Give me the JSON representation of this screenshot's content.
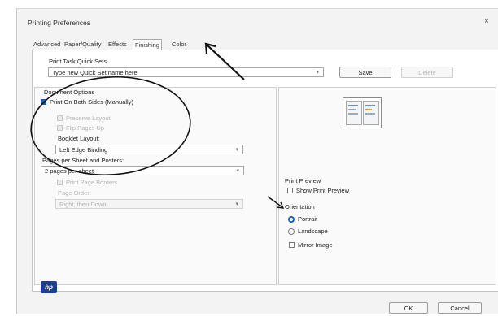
{
  "window": {
    "title": "Printing Preferences",
    "close": "×"
  },
  "tabs": [
    "Advanced",
    "Paper/Quality",
    "Effects",
    "Finishing",
    "Color"
  ],
  "active_tab": "Finishing",
  "quick_sets": {
    "label": "Print Task Quick Sets",
    "value": "Type new Quick Set name here",
    "save": "Save",
    "delete": "Delete"
  },
  "document_options": {
    "label": "Document Options",
    "print_both_sides": "Print On Both Sides (Manually)",
    "preserve_layout": "Preserve Layout",
    "flip_pages_up": "Flip Pages Up",
    "booklet_layout_label": "Booklet Layout:",
    "booklet_layout_value": "Left Edge Binding",
    "pages_per_sheet_label": "Pages per Sheet and Posters:",
    "pages_per_sheet_value": "2 pages per sheet",
    "print_page_borders": "Print Page Borders",
    "page_order_label": "Page Order:",
    "page_order_value": "Right, then Down"
  },
  "print_preview": {
    "label": "Print Preview",
    "show": "Show Print Preview"
  },
  "orientation": {
    "label": "Orientation",
    "options": [
      "Portrait",
      "Landscape"
    ],
    "selected": "Portrait",
    "mirror_image": "Mirror Image"
  },
  "footer": {
    "logo": "hp",
    "ok": "OK",
    "cancel": "Cancel"
  },
  "colors": {
    "accent": "#1a5fb4",
    "annotation": "#111111"
  }
}
